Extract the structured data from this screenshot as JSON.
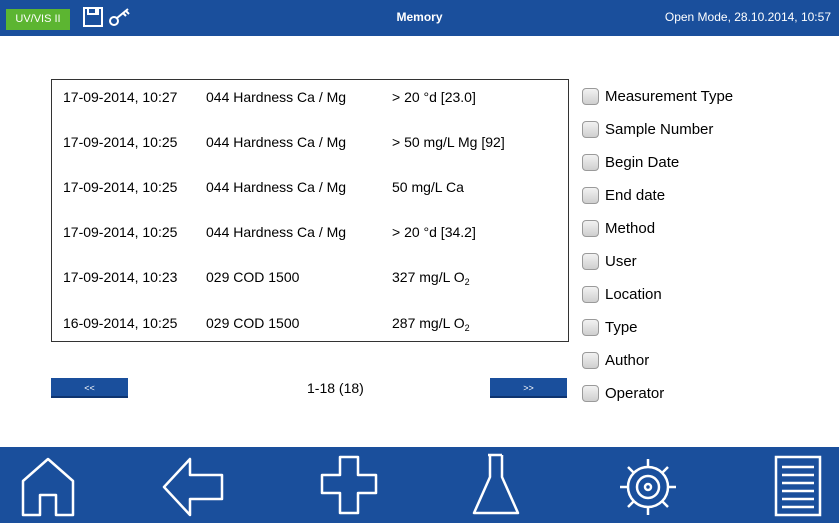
{
  "header": {
    "mode_badge": "UV/VIS II",
    "title": "Memory",
    "status": "Open Mode, 28.10.2014, 10:57"
  },
  "list": {
    "rows": [
      {
        "date": "17-09-2014, 10:27",
        "method": "044 Hardness Ca / Mg",
        "result": "> 20 °d [23.0]"
      },
      {
        "date": "17-09-2014, 10:25",
        "method": "044 Hardness Ca / Mg",
        "result": "> 50 mg/L Mg [92]"
      },
      {
        "date": "17-09-2014, 10:25",
        "method": "044 Hardness Ca / Mg",
        "result": "50 mg/L Ca"
      },
      {
        "date": "17-09-2014, 10:25",
        "method": "044 Hardness Ca / Mg",
        "result": "> 20 °d [34.2]"
      },
      {
        "date": "17-09-2014, 10:23",
        "method": "029 COD 1500",
        "result": "327 mg/L O",
        "result_sub": "2"
      },
      {
        "date": "16-09-2014, 10:25",
        "method": "029 COD 1500",
        "result": "287 mg/L O",
        "result_sub": "2"
      }
    ]
  },
  "pager": {
    "prev_label": "<<",
    "next_label": ">>",
    "range": "1-18 (18)"
  },
  "filters": [
    {
      "label": "Measurement Type",
      "checked": false
    },
    {
      "label": "Sample Number",
      "checked": false
    },
    {
      "label": "Begin Date",
      "checked": false
    },
    {
      "label": "End date",
      "checked": false
    },
    {
      "label": "Method",
      "checked": false
    },
    {
      "label": "User",
      "checked": false
    },
    {
      "label": "Location",
      "checked": false
    },
    {
      "label": "Type",
      "checked": false
    },
    {
      "label": "Author",
      "checked": false
    },
    {
      "label": "Operator",
      "checked": false
    }
  ],
  "footer": {
    "icons": [
      "home-icon",
      "back-arrow-icon",
      "plus-icon",
      "flask-icon",
      "settings-gear-icon",
      "list-icon"
    ]
  },
  "colors": {
    "bar_blue": "#1a4f9c",
    "badge_green": "#5cb531"
  }
}
